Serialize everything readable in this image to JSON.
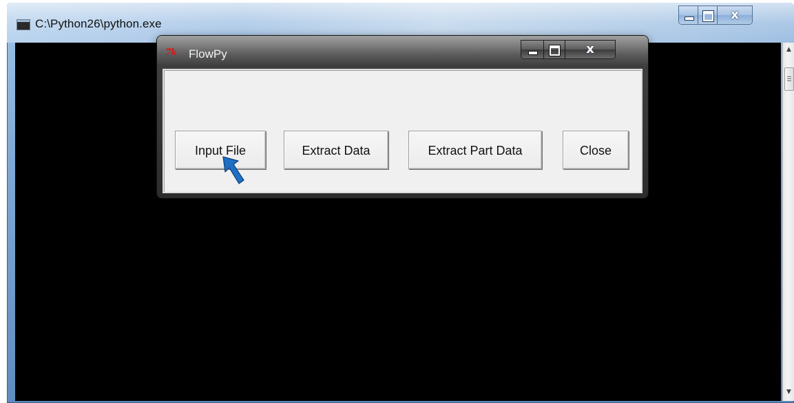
{
  "console": {
    "title": "C:\\Python26\\python.exe",
    "scrollbar": {
      "up_arrow": "▲",
      "down_arrow": "▼"
    }
  },
  "dialog": {
    "title": "FlowPy",
    "icon": "tk-icon",
    "icon_text": "7k"
  },
  "buttons": {
    "input_file": "Input File",
    "extract_data": "Extract Data",
    "extract_part_data": "Extract Part Data",
    "close": "Close"
  },
  "caption_glyphs": {
    "minimize": "",
    "maximize": "",
    "close": "x"
  },
  "colors": {
    "console_bg": "#000000",
    "dialog_frame": "#2c2c2c",
    "dialog_client": "#f0f0f0",
    "annotation_arrow": "#1f6fc5"
  }
}
